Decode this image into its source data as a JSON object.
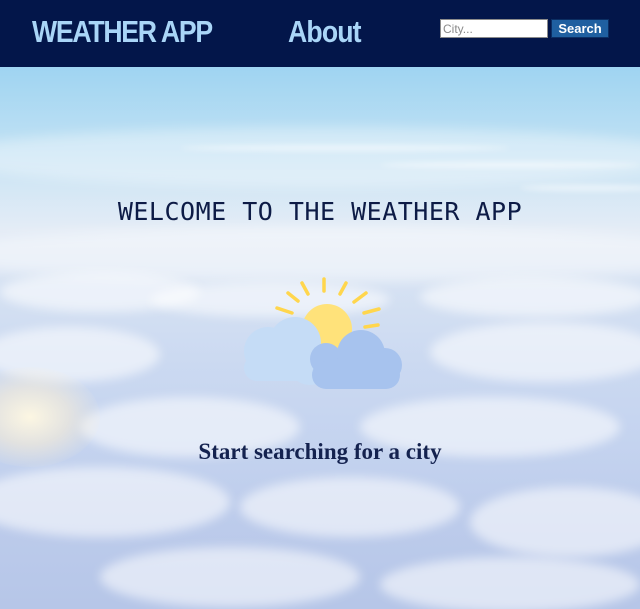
{
  "header": {
    "brand": "WEATHER APP",
    "about_label": "About",
    "search": {
      "placeholder": "City...",
      "value": "",
      "button_label": "Search"
    }
  },
  "main": {
    "welcome_heading": "WELCOME TO THE WEATHER APP",
    "hero_icon": "partly-cloudy-sun-icon",
    "prompt": "Start searching for a city"
  },
  "colors": {
    "navbar": "#03164a",
    "nav_text": "#a9d5f7",
    "search_button": "#1f5fa0",
    "heading_text": "#0d1b46",
    "sun": "#ffe27a",
    "cloud_front": "#a7c3ee",
    "cloud_back": "#c5dcf6"
  }
}
